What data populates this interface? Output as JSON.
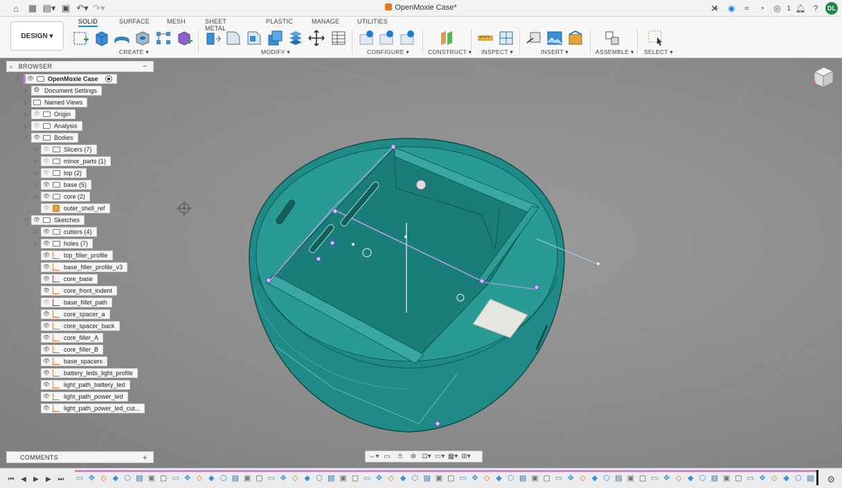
{
  "titlebar": {
    "document_title": "OpenMoxie Case*",
    "job_count": "1",
    "user_initials": "DL"
  },
  "ribbon": {
    "workspace": "DESIGN",
    "tabs": [
      "SOLID",
      "SURFACE",
      "MESH",
      "SHEET METAL",
      "PLASTIC",
      "MANAGE",
      "UTILITIES"
    ],
    "active_tab": "SOLID",
    "groups": [
      "CREATE",
      "MODIFY",
      "CONFIGURE",
      "CONSTRUCT",
      "INSPECT",
      "INSERT",
      "ASSEMBLE",
      "SELECT"
    ]
  },
  "browser": {
    "title": "BROWSER",
    "root": "OpenMoxie Case",
    "items": [
      {
        "label": "Document Settings",
        "icon": "gear-icon",
        "eye": false
      },
      {
        "label": "Named Views",
        "icon": "folder-icon",
        "eye": false
      },
      {
        "label": "Origin",
        "icon": "folder-icon",
        "eye": true,
        "hidden": true
      },
      {
        "label": "Analysis",
        "icon": "folder-icon",
        "eye": true,
        "hidden": true
      },
      {
        "label": "Bodies",
        "icon": "folder-icon",
        "eye": true
      },
      {
        "label": "Slicers (7)",
        "icon": "folder-icon",
        "eye": true,
        "hidden": true
      },
      {
        "label": "minor_parts (1)",
        "icon": "folder-icon",
        "eye": true,
        "hidden": true
      },
      {
        "label": "top (2)",
        "icon": "folder-icon",
        "eye": true,
        "hidden": true
      },
      {
        "label": "base (5)",
        "icon": "folder-icon",
        "eye": true
      },
      {
        "label": "core (2)",
        "icon": "folder-icon",
        "eye": true
      },
      {
        "label": "outer_shell_ref",
        "icon": "body-icon",
        "eye": true,
        "hidden": true
      },
      {
        "label": "Sketches",
        "icon": "folder-icon",
        "eye": true
      },
      {
        "label": "cutters (4)",
        "icon": "folder-icon",
        "eye": true
      },
      {
        "label": "holes (7)",
        "icon": "folder-icon",
        "eye": true
      },
      {
        "label": "top_filler_profile",
        "icon": "sketch-icon",
        "eye": true
      },
      {
        "label": "base_filler_profile_v3",
        "icon": "sketch-icon",
        "eye": true
      },
      {
        "label": "core_base",
        "icon": "sketch-red-icon",
        "eye": true
      },
      {
        "label": "core_front_indent",
        "icon": "sketch-icon",
        "eye": true
      },
      {
        "label": "base_fillet_path",
        "icon": "sketch-red-icon",
        "eye": true,
        "hidden": true
      },
      {
        "label": "core_spacer_a",
        "icon": "sketch-icon",
        "eye": true
      },
      {
        "label": "core_spacer_back",
        "icon": "sketch-icon",
        "eye": true
      },
      {
        "label": "core_filler_A",
        "icon": "sketch-icon",
        "eye": true
      },
      {
        "label": "core_filler_B",
        "icon": "sketch-icon",
        "eye": true
      },
      {
        "label": "base_spacers",
        "icon": "sketch-icon",
        "eye": true
      },
      {
        "label": "battery_leds_light_profile",
        "icon": "sketch-icon",
        "eye": true
      },
      {
        "label": "light_path_battery_led",
        "icon": "sketch-icon",
        "eye": true
      },
      {
        "label": "light_path_power_led",
        "icon": "sketch-icon",
        "eye": true
      },
      {
        "label": "light_path_power_led_cut...",
        "icon": "sketch-icon",
        "eye": true
      }
    ]
  },
  "comments": {
    "title": "COMMENTS"
  },
  "colors": {
    "model_teal": "#1f8a86",
    "sketch_purple": "#9b7fe0",
    "accent_blue": "#0696d7",
    "timeline_track": "#d97bd9"
  }
}
